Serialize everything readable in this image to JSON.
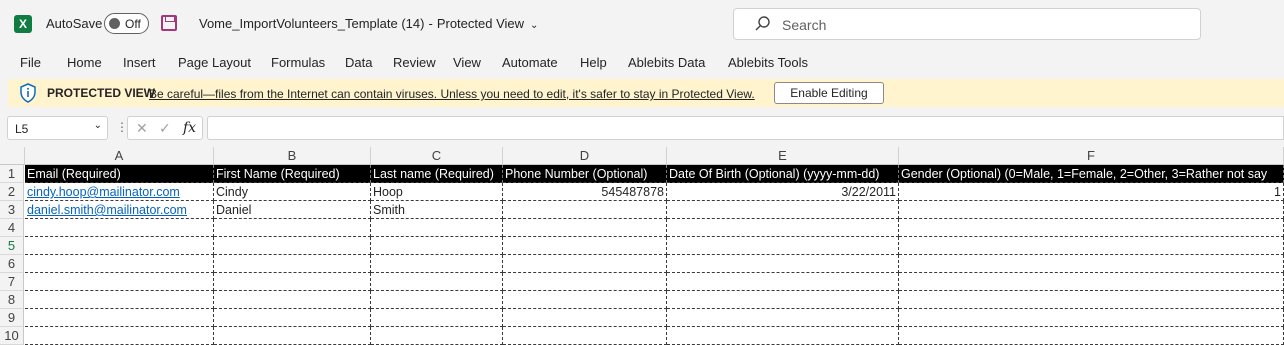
{
  "app": {
    "autosave_label": "AutoSave",
    "autosave_state": "Off",
    "doc_title": "Vome_ImportVolunteers_Template (14)",
    "doc_sep": "-",
    "doc_mode": "Protected View",
    "search_placeholder": "Search",
    "logo": "X"
  },
  "menu": [
    "File",
    "Home",
    "Insert",
    "Page Layout",
    "Formulas",
    "Data",
    "Review",
    "View",
    "Automate",
    "Help",
    "Ablebits Data",
    "Ablebits Tools"
  ],
  "protected_view": {
    "title": "PROTECTED VIEW",
    "message": "Be careful—files from the Internet can contain viruses. Unless you need to edit, it's safer to stay in Protected View.",
    "button": "Enable Editing"
  },
  "formula_bar": {
    "name_box": "L5",
    "dots": "⋮",
    "cancel": "✕",
    "enter": "✓",
    "fx": "fx",
    "formula": ""
  },
  "sheet": {
    "columns": [
      "A",
      "B",
      "C",
      "D",
      "E",
      "F"
    ],
    "rows": [
      "1",
      "2",
      "3",
      "4",
      "5",
      "6",
      "7",
      "8",
      "9",
      "10"
    ],
    "selected_row": "5",
    "header": [
      "Email (Required)",
      "First Name (Required)",
      "Last name (Required)",
      "Phone Number (Optional)",
      "Date Of Birth (Optional) (yyyy-mm-dd)",
      "Gender (Optional) (0=Male, 1=Female, 2=Other, 3=Rather not say"
    ],
    "data": [
      [
        "cindy.hoop@mailinator.com",
        "Cindy",
        "Hoop",
        "545487878",
        "3/22/2011",
        "1"
      ],
      [
        "daniel.smith@mailinator.com",
        "Daniel",
        "Smith",
        "",
        "",
        ""
      ]
    ]
  }
}
